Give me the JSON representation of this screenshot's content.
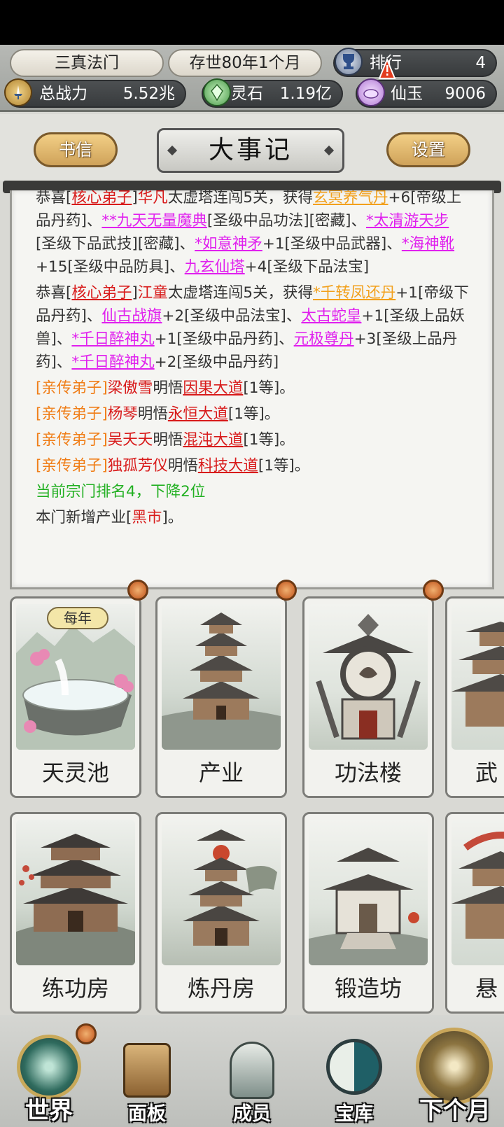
{
  "header": {
    "sect_name": "三真法门",
    "era": "存世80年1个月",
    "rank_label": "排行",
    "rank_value": "4",
    "power_label": "总战力",
    "power_value": "5.52兆",
    "stone_label": "灵石",
    "stone_value": "1.19亿",
    "jade_label": "仙玉",
    "jade_value": "9006"
  },
  "titlebar": {
    "left_button": "书信",
    "title": "大事记",
    "right_button": "设置"
  },
  "log": {
    "e1": {
      "p1": "恭喜[",
      "who": "核心弟子",
      "p2": "]",
      "name": "华凡",
      "p3": "太虚塔连闯5关，获得",
      "i1": "玄冥养气丹",
      "p4": "+6[帝级上品丹药]、",
      "i2": "**九天无量魔典",
      "p5": "[圣级中品功法][密藏]、",
      "i3": "*太清游天步",
      "p6": "[圣级下品武技][密藏]、",
      "i4": "*如意神矛",
      "p7": "+1[圣级中品武器]、",
      "i5": "*海神靴",
      "p8": "+15[圣级中品防具]、",
      "i6": "九玄仙塔",
      "p9": "+4[圣级下品法宝]"
    },
    "e2": {
      "p1": "恭喜[",
      "who": "核心弟子",
      "p2": "]",
      "name": "江童",
      "p3": "太虚塔连闯5关，获得",
      "i1": "*千转凤还丹",
      "p4": "+1[帝级下品丹药]、",
      "i2": "仙古战旗",
      "p5": "+2[圣级中品法宝]、",
      "i3": "太古蛇皇",
      "p6": "+1[圣级上品妖兽]、",
      "i4": "*千日醉神丸",
      "p7": "+1[圣级中品丹药]、",
      "i5": "元极尊丹",
      "p8": "+3[圣级上品丹药]、",
      "i6": "*千日醉神丸",
      "p9": "+2[圣级中品丹药]"
    },
    "d1": {
      "open": "[",
      "who": "亲传弟子",
      "close": "]",
      "name": "梁傲雪",
      "verb": "明悟",
      "dao": "因果大道",
      "tail": "[1等]。"
    },
    "d2": {
      "open": "[",
      "who": "亲传弟子",
      "close": "]",
      "name": "杨琴",
      "verb": "明悟",
      "dao": "永恒大道",
      "tail": "[1等]。"
    },
    "d3": {
      "open": "[",
      "who": "亲传弟子",
      "close": "]",
      "name": "吴夭夭",
      "verb": "明悟",
      "dao": "混沌大道",
      "tail": "[1等]。"
    },
    "d4": {
      "open": "[",
      "who": "亲传弟子",
      "close": "]",
      "name": "独孤芳仪",
      "verb": "明悟",
      "dao": "科技大道",
      "tail": "[1等]。"
    },
    "rank_msg": "当前宗门排名4，下降2位",
    "industry": {
      "p1": "本门新增产业[",
      "name": "黑市",
      "p2": "]。"
    }
  },
  "buildings": {
    "row1": [
      "天灵池",
      "产业",
      "功法楼",
      "武"
    ],
    "row2": [
      "练功房",
      "炼丹房",
      "锻造坊",
      "悬"
    ],
    "yearly_badge": "每年"
  },
  "nav": {
    "world": "世界",
    "panel": "面板",
    "members": "成员",
    "treasury": "宝库",
    "next_month": "下个月"
  },
  "colors": {
    "core_disciple": "#d81b1b",
    "item_purple": "#e020ee",
    "item_gold": "#f2a01c",
    "direct_disciple": "#f07e18",
    "rank_green": "#22b022",
    "gold_button": "#e0b56a"
  }
}
